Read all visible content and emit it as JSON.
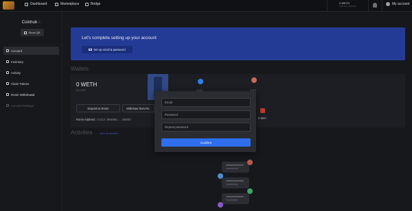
{
  "nav": {
    "dashboard": "Dashboard",
    "marketplace": "Marketplace",
    "bridge": "Bridge",
    "weth_balance": "0 WETH",
    "weth_sub": "ronin:90...0x69450",
    "my_account": "My account"
  },
  "sidebar": {
    "profile_name": "Coinhub",
    "show_qr": "Show QR",
    "items": [
      {
        "label": "Account"
      },
      {
        "label": "Inventory"
      },
      {
        "label": "Activity"
      },
      {
        "label": "Claim Tokens"
      },
      {
        "label": "Ronin Withdrawal"
      },
      {
        "label": "Account Settings"
      }
    ]
  },
  "banner": {
    "title": "Let's complete setting up your account",
    "button": "Set up email & password"
  },
  "wallets": {
    "title": "Wallets",
    "weth": "0 WETH",
    "usd": "$ 0 USD",
    "deposit": "Deposit to Ronin",
    "withdraw": "Withdraw from Ro",
    "ronin_label": "Ronin Address:",
    "ronin_address": "ronin:905995...0695b",
    "token1": "0 AXS",
    "token2": "0 SLP",
    "items": "0 Item"
  },
  "activities": {
    "title": "Activities",
    "view_link": "View all activities ›"
  },
  "modal": {
    "email_placeholder": "Email",
    "password_placeholder": "Password",
    "repeat_placeholder": "Repeat password",
    "confirm": "Confirm"
  },
  "colors": {
    "banner": "#243b96",
    "confirm": "#2f6fed",
    "background": "#17181c"
  }
}
